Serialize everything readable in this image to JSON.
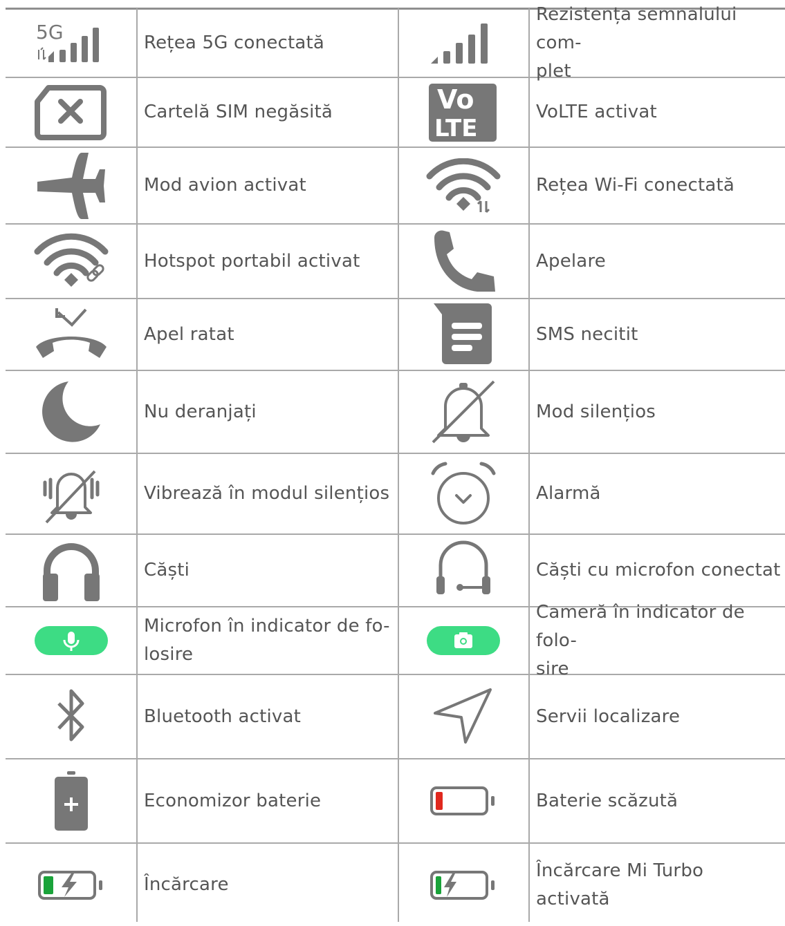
{
  "rows": [
    {
      "left": {
        "icon": "5g-signal-icon",
        "label": "Rețea 5G conectată"
      },
      "right": {
        "icon": "full-signal-icon",
        "label": "Rezistența semnalului com-\nplet"
      }
    },
    {
      "left": {
        "icon": "sim-missing-icon",
        "label": "Cartelă SIM negăsită"
      },
      "right": {
        "icon": "volte-icon",
        "label": "VoLTE activat",
        "icon_text": [
          "Vo",
          "LTE"
        ]
      }
    },
    {
      "left": {
        "icon": "airplane-icon",
        "label": "Mod avion activat"
      },
      "right": {
        "icon": "wifi-connected-icon",
        "label": "Rețea Wi-Fi conectată"
      }
    },
    {
      "left": {
        "icon": "hotspot-icon",
        "label": "Hotspot portabil activat"
      },
      "right": {
        "icon": "phone-call-icon",
        "label": "Apelare"
      }
    },
    {
      "left": {
        "icon": "missed-call-icon",
        "label": "Apel ratat"
      },
      "right": {
        "icon": "unread-sms-icon",
        "label": "SMS necitit"
      }
    },
    {
      "left": {
        "icon": "moon-icon",
        "label": "Nu deranjați"
      },
      "right": {
        "icon": "silent-bell-icon",
        "label": "Mod silențios"
      }
    },
    {
      "left": {
        "icon": "vibrate-silent-icon",
        "label": "Vibrează în modul silențios"
      },
      "right": {
        "icon": "alarm-clock-icon",
        "label": "Alarmă"
      }
    },
    {
      "left": {
        "icon": "headphones-icon",
        "label": "Căști"
      },
      "right": {
        "icon": "headset-mic-icon",
        "label": "Căști cu microfon conectat"
      }
    },
    {
      "left": {
        "icon": "mic-in-use-icon",
        "label": "Microfon în indicator de fo-\nlosire"
      },
      "right": {
        "icon": "camera-in-use-icon",
        "label": "Cameră în indicator de folo-\nsire"
      }
    },
    {
      "left": {
        "icon": "bluetooth-icon",
        "label": "Bluetooth activat"
      },
      "right": {
        "icon": "location-icon",
        "label": "Servii localizare"
      }
    },
    {
      "left": {
        "icon": "battery-saver-icon",
        "label": "Economizor baterie"
      },
      "right": {
        "icon": "low-battery-icon",
        "label": "Baterie scăzută"
      }
    },
    {
      "left": {
        "icon": "charging-icon",
        "label": "Încărcare"
      },
      "right": {
        "icon": "turbo-charging-icon",
        "label": "Încărcare Mi Turbo activată"
      }
    }
  ],
  "colors": {
    "icon_gray": "#777777",
    "grid_line": "#a9a9a9",
    "text": "#555555",
    "in_use_green": "#3ddc84",
    "battery_low_red": "#e0281e",
    "battery_charge_green": "#1aa33a"
  }
}
